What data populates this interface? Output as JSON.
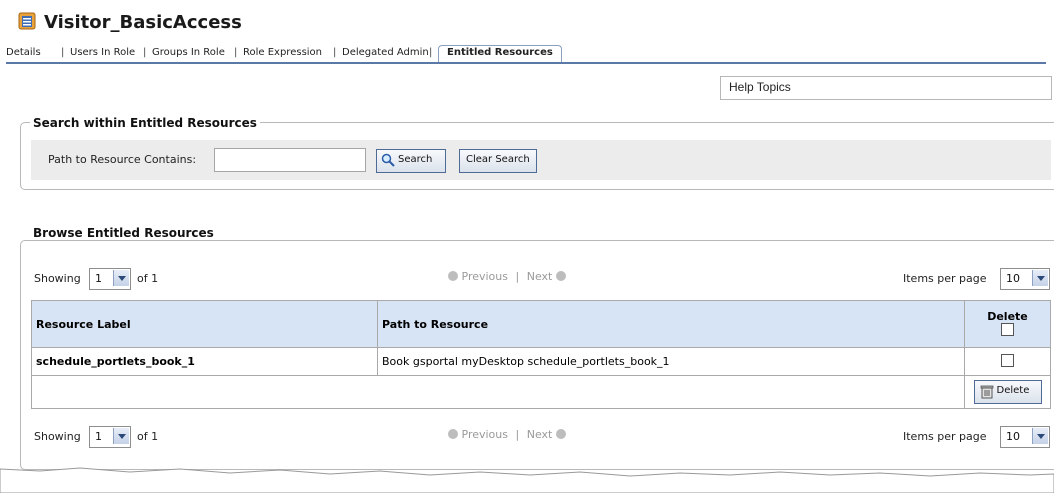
{
  "page": {
    "title": "Visitor_BasicAccess",
    "help_topics": "Help Topics"
  },
  "tabs": [
    {
      "label": "Details"
    },
    {
      "label": "Users In Role"
    },
    {
      "label": "Groups In Role"
    },
    {
      "label": "Role Expression"
    },
    {
      "label": "Delegated Admin"
    },
    {
      "label": "Entitled Resources",
      "active": true
    }
  ],
  "search": {
    "legend": "Search within Entitled Resources",
    "label": "Path to Resource Contains:",
    "value": "",
    "search_button": "Search",
    "clear_button": "Clear Search"
  },
  "browse": {
    "legend": "Browse Entitled Resources",
    "top_pager": {
      "showing_label": "Showing",
      "page_value": "1",
      "of_text": "of 1",
      "previous": "Previous",
      "next": "Next",
      "items_label": "Items per page",
      "items_value": "10"
    },
    "bottom_pager": {
      "showing_label": "Showing",
      "page_value": "1",
      "of_text": "of 1",
      "previous": "Previous",
      "next": "Next",
      "items_label": "Items per page",
      "items_value": "10"
    },
    "table": {
      "headers": [
        "Resource Label",
        "Path to Resource",
        "Delete"
      ],
      "rows": [
        {
          "label": "schedule_portlets_book_1",
          "path": "Book gsportal myDesktop schedule_portlets_book_1"
        }
      ],
      "delete_button": "Delete"
    }
  },
  "colors": {
    "tab_line": "#5a79a6",
    "header_bg": "#d7e4f5",
    "search_bg": "#ececec"
  }
}
